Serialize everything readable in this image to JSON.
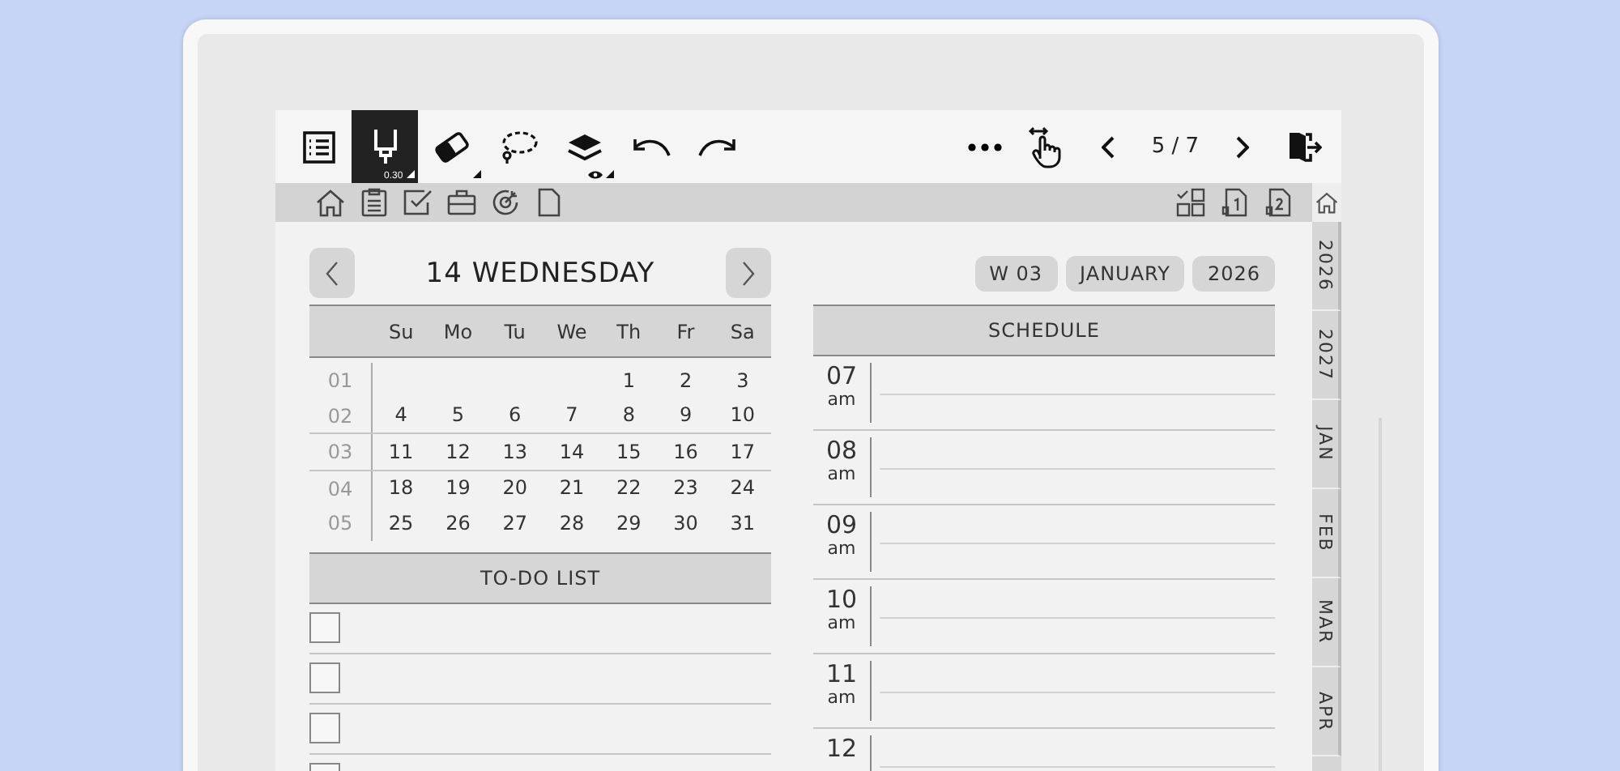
{
  "toolbar": {
    "left_tools": [
      {
        "kind": "outline",
        "selected": false
      },
      {
        "kind": "pen",
        "selected": true,
        "caption": "0.30"
      },
      {
        "kind": "eraser",
        "selected": false
      },
      {
        "kind": "lasso",
        "selected": false
      },
      {
        "kind": "layers",
        "selected": false
      },
      {
        "kind": "undo",
        "selected": false
      },
      {
        "kind": "redo",
        "selected": false
      }
    ],
    "right_tools": [
      {
        "kind": "more"
      },
      {
        "kind": "touch"
      },
      {
        "kind": "prev"
      },
      {
        "kind": "page",
        "text": "5 / 7"
      },
      {
        "kind": "next"
      },
      {
        "kind": "exit"
      }
    ]
  },
  "nav_bar": {
    "left": [
      {
        "kind": "home"
      },
      {
        "kind": "clipboard"
      },
      {
        "kind": "checkbox"
      },
      {
        "kind": "briefcase"
      },
      {
        "kind": "target"
      },
      {
        "kind": "page"
      }
    ],
    "right": [
      {
        "kind": "grid"
      },
      {
        "kind": "page1"
      },
      {
        "kind": "page2"
      }
    ]
  },
  "day_header": {
    "title": "14 WEDNESDAY"
  },
  "chips": [
    "W 03",
    "JANUARY",
    "2026"
  ],
  "calendar": {
    "weekdays": [
      "Su",
      "Mo",
      "Tu",
      "We",
      "Th",
      "Fr",
      "Sa"
    ],
    "weeks": [
      {
        "number": "01",
        "days": [
          "1",
          "2",
          "3"
        ]
      },
      {
        "number": "02",
        "days": [
          "4",
          "5",
          "6",
          "7",
          "8",
          "9",
          "10"
        ]
      },
      {
        "number": "03",
        "days": [
          "11",
          "12",
          "13",
          "14",
          "15",
          "16",
          "17"
        ]
      },
      {
        "number": "04",
        "days": [
          "18",
          "19",
          "20",
          "21",
          "22",
          "23",
          "24"
        ]
      },
      {
        "number": "05",
        "days": [
          "25",
          "26",
          "27",
          "28",
          "29",
          "30",
          "31"
        ]
      }
    ]
  },
  "todo": {
    "title": "TO-DO LIST",
    "items": [
      {
        "checked": false
      },
      {
        "checked": false
      },
      {
        "checked": false
      },
      {
        "checked": false
      }
    ]
  },
  "schedule": {
    "title": "SCHEDULE",
    "hours": [
      {
        "hour": "07",
        "period": "am"
      },
      {
        "hour": "08",
        "period": "am"
      },
      {
        "hour": "09",
        "period": "am"
      },
      {
        "hour": "10",
        "period": "am"
      },
      {
        "hour": "11",
        "period": "am"
      },
      {
        "hour": "12"
      }
    ]
  },
  "side_tabs": [
    "2026",
    "2027",
    "JAN",
    "FEB",
    "MAR",
    "APR"
  ]
}
